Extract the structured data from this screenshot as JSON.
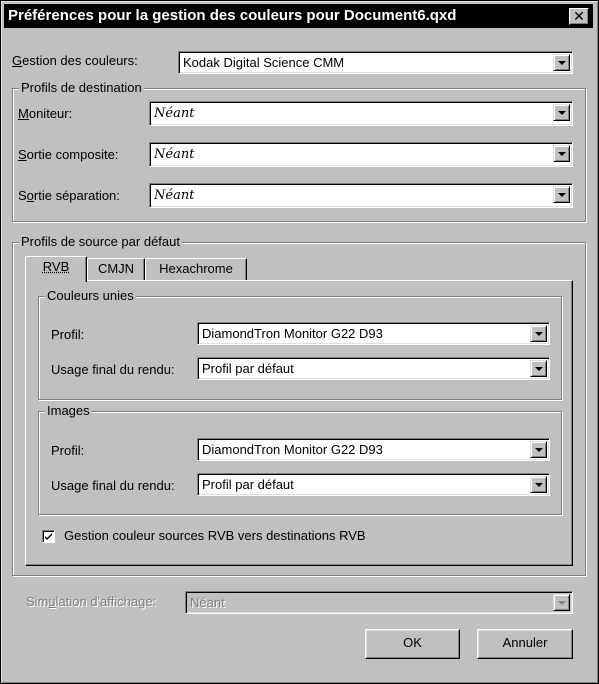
{
  "window": {
    "title": "Préférences pour la gestion des couleurs pour Document6.qxd",
    "close_symbol": "✕"
  },
  "color_management": {
    "label_first": "G",
    "label_rest": "estion des couleurs:",
    "value": "Kodak Digital Science CMM"
  },
  "destination": {
    "group_title": "Profils de destination",
    "monitor": {
      "label_first": "M",
      "label_rest": "oniteur:",
      "value": "Néant"
    },
    "composite": {
      "label_first": "S",
      "label_rest": "ortie composite:",
      "value": "Néant"
    },
    "separation": {
      "label_pre": "S",
      "label_key": "o",
      "label_rest": "rtie séparation:",
      "value": "Néant"
    }
  },
  "source": {
    "group_title": "Profils de source par défaut",
    "tabs": [
      {
        "label": "RVB",
        "active": true
      },
      {
        "label": "CMJN",
        "active": false
      },
      {
        "label": "Hexachrome",
        "active": false
      }
    ],
    "solid_colors": {
      "group_title": "Couleurs unies",
      "profile_label": "Profil:",
      "profile_value": "DiamondTron Monitor G22 D93",
      "intent_label": "Usage final du rendu:",
      "intent_value": "Profil par défaut"
    },
    "images": {
      "group_title": "Images",
      "profile_label": "Profil:",
      "profile_value": "DiamondTron Monitor G22 D93",
      "intent_label": "Usage final du rendu:",
      "intent_value": "Profil par défaut"
    },
    "rgb_to_rgb": {
      "label": "Gestion couleur sources RVB vers destinations RVB",
      "checked": true
    }
  },
  "display_simulation": {
    "label_pre": "Sim",
    "label_key": "u",
    "label_rest": "lation d'affichage:",
    "value": "Néant",
    "enabled": false
  },
  "buttons": {
    "ok": "OK",
    "cancel": "Annuler"
  }
}
